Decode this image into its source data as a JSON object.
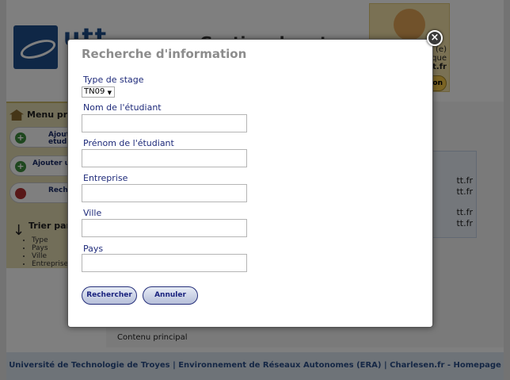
{
  "background": {
    "header_title": "Gestion des stages",
    "promo": {
      "lines": [
        "(e)",
        "que",
        "tt.fr"
      ],
      "button": "on"
    },
    "menu": {
      "title": "Menu pri",
      "buttons": [
        {
          "label": "Ajout\netud"
        },
        {
          "label": "Ajouter u"
        },
        {
          "label": "Rech"
        }
      ],
      "sort_title": "Trier par",
      "sort_items": [
        "Type",
        "Pays",
        "Ville",
        "Entreprise"
      ]
    },
    "mail_items": [
      "tt.fr",
      "tt.fr",
      "tt.fr",
      "tt.fr",
      "tt.fr"
    ],
    "content_label": "Contenu principal",
    "footer": "Université de Technologie de Troyes | Environnement de Réseaux Autonomes (ERA) | Charlesen.fr - Homepage"
  },
  "modal": {
    "title": "Recherche d'information",
    "type_label": "Type de stage",
    "type_value": "TN09",
    "fields": [
      {
        "label": "Nom de l'étudiant",
        "value": ""
      },
      {
        "label": "Prénom de l'étudiant",
        "value": ""
      },
      {
        "label": "Entreprise",
        "value": ""
      },
      {
        "label": "Ville",
        "value": ""
      },
      {
        "label": "Pays",
        "value": ""
      }
    ],
    "search_button": "Rechercher",
    "cancel_button": "Annuler",
    "close_glyph": "×"
  },
  "colors": {
    "overlay": "#000000",
    "label": "#1e2a7a",
    "title": "#8c8c8c",
    "button_border": "#26307a"
  }
}
